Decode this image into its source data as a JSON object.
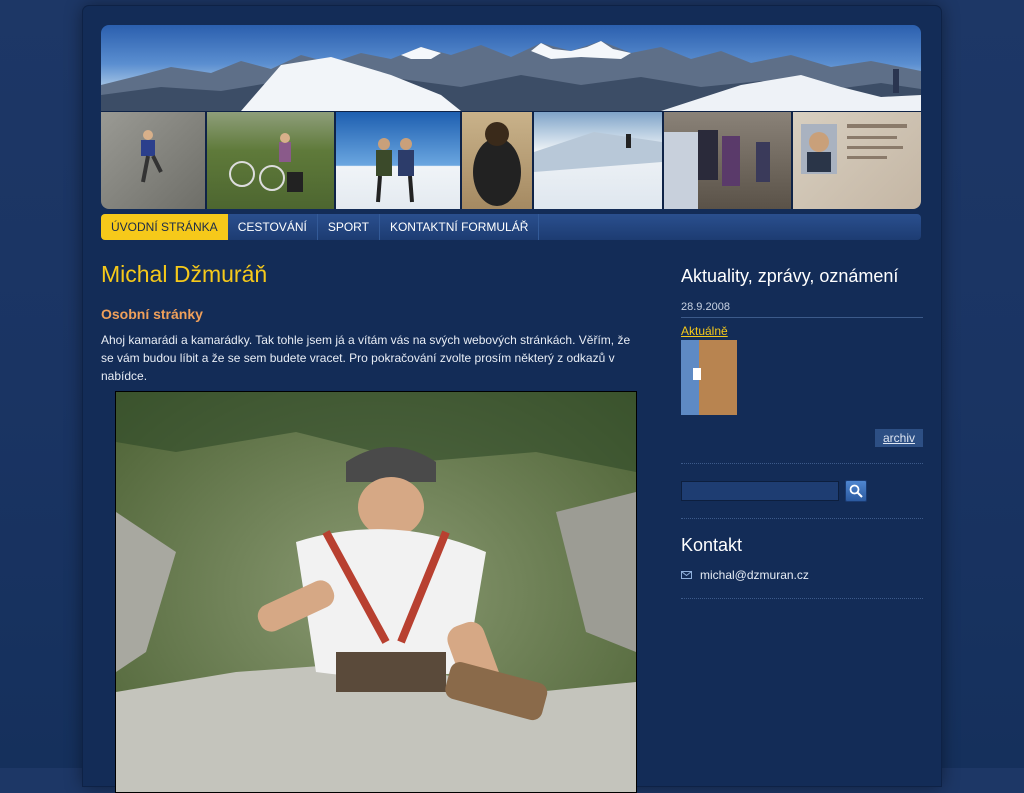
{
  "nav": {
    "items": [
      {
        "label": "Úvodní stránka",
        "active": true
      },
      {
        "label": "Cestování",
        "active": false
      },
      {
        "label": "Sport",
        "active": false
      },
      {
        "label": "Kontaktní formulář",
        "active": false
      }
    ]
  },
  "main": {
    "title": "Michal Džmuráň",
    "subtitle": "Osobní stránky",
    "intro": "Ahoj kamarádi a kamarádky. Tak tohle jsem já a vítám vás na svých webových stránkách. Věřím, že se vám budou líbit a že se sem budete vracet. Pro pokračování zvolte prosím některý z odkazů v nabídce."
  },
  "sidebar": {
    "news_heading": "Aktuality, zprávy, oznámení",
    "news_date": "28.9.2008",
    "news_link": "Aktuálně",
    "archive_label": "archiv",
    "search_value": "",
    "contact_heading": "Kontakt",
    "contact_email": "michal@dzmuran.cz"
  },
  "colors": {
    "accent": "#f6c91a",
    "subtitle": "#f0a05a",
    "background": "#15305c"
  }
}
